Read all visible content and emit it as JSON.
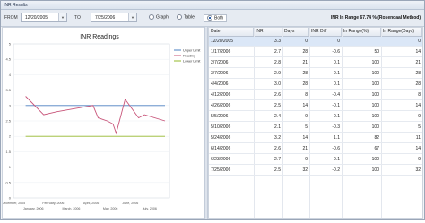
{
  "window": {
    "title": "INR Results"
  },
  "toolbar": {
    "from_label": "FROM",
    "from_value": "12/20/2005",
    "to_label": "TO",
    "to_value": "7/25/2006",
    "options": [
      "Graph",
      "Table",
      "Both"
    ],
    "selected_option": "Both",
    "inr_range_text": "INR In Range 67.74 % (Rosendaal Method)"
  },
  "chart": {
    "title": "INR Readings",
    "legend": [
      "Upper Limit",
      "Reading",
      "Lower Limit"
    ],
    "y_ticks": [
      "5",
      "4.5",
      "4",
      "3.5",
      "3",
      "2.5",
      "2",
      "1.5",
      "1",
      "0.5",
      "0"
    ],
    "x_ticks_top": [
      "December, 2005",
      "February, 2006",
      "April, 2006",
      "June, 2006"
    ],
    "x_ticks_bottom": [
      "January, 2006",
      "March, 2006",
      "May, 2006",
      "July, 2006"
    ]
  },
  "chart_data": {
    "type": "line",
    "title": "INR Readings",
    "ylim": [
      0,
      5
    ],
    "legend_position": "top-right",
    "series": [
      {
        "name": "Upper Limit",
        "color": "#4a7fc0",
        "x": [
          "12/20/2005",
          "7/25/2006"
        ],
        "values": [
          3,
          3
        ]
      },
      {
        "name": "Reading",
        "color": "#c8557a",
        "x": [
          "12/20/2005",
          "1/17/2006",
          "2/7/2006",
          "3/7/2006",
          "4/4/2006",
          "4/12/2006",
          "4/26/2006",
          "5/5/2006",
          "5/10/2006",
          "5/24/2006",
          "6/14/2006",
          "6/23/2006",
          "7/25/2006"
        ],
        "values": [
          3.3,
          2.7,
          2.8,
          2.9,
          3.0,
          2.6,
          2.5,
          2.4,
          2.1,
          3.2,
          2.6,
          2.7,
          2.5
        ]
      },
      {
        "name": "Lower Limit",
        "color": "#93b82a",
        "x": [
          "12/20/2005",
          "7/25/2006"
        ],
        "values": [
          2,
          2
        ]
      }
    ]
  },
  "table": {
    "columns": [
      "Date",
      "INR",
      "Days",
      "INR Diff",
      "In Range(%)",
      "In Range(Days)"
    ],
    "rows": [
      [
        "12/20/2005",
        "3.3",
        "0",
        "0",
        "",
        "0"
      ],
      [
        "1/17/2006",
        "2.7",
        "28",
        "-0.6",
        "50",
        "14"
      ],
      [
        "2/7/2006",
        "2.8",
        "21",
        "0.1",
        "100",
        "21"
      ],
      [
        "3/7/2006",
        "2.9",
        "28",
        "0.1",
        "100",
        "28"
      ],
      [
        "4/4/2006",
        "3.0",
        "28",
        "0.1",
        "100",
        "28"
      ],
      [
        "4/12/2006",
        "2.6",
        "8",
        "-0.4",
        "100",
        "8"
      ],
      [
        "4/26/2006",
        "2.5",
        "14",
        "-0.1",
        "100",
        "14"
      ],
      [
        "5/5/2006",
        "2.4",
        "9",
        "-0.1",
        "100",
        "9"
      ],
      [
        "5/10/2006",
        "2.1",
        "5",
        "-0.3",
        "100",
        "5"
      ],
      [
        "5/24/2006",
        "3.2",
        "14",
        "1.1",
        "82",
        "11"
      ],
      [
        "6/14/2006",
        "2.6",
        "21",
        "-0.6",
        "67",
        "14"
      ],
      [
        "6/23/2006",
        "2.7",
        "9",
        "0.1",
        "100",
        "9"
      ],
      [
        "7/25/2006",
        "2.5",
        "32",
        "-0.2",
        "100",
        "32"
      ]
    ]
  }
}
